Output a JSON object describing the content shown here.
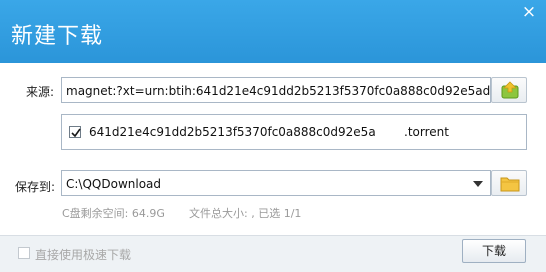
{
  "window": {
    "title": "新建下载",
    "close_glyph": "×"
  },
  "source": {
    "label": "来源:",
    "url": "magnet:?xt=urn:btih:641d21e4c91dd2b5213f5370fc0a888c0d92e5ad",
    "add_icon": "add-torrent-icon"
  },
  "file": {
    "checked": true,
    "name_part1": "641d21e4c91dd2b5213f5370fc0a888c0d92e5a",
    "name_part2": ".torrent"
  },
  "save": {
    "label": "保存到:",
    "path": "C:\\QQDownload",
    "browse_icon": "folder-icon"
  },
  "info": {
    "free_space": "C盘剩余空间: 64.9G",
    "file_summary": "文件总大小: , 已选 1/1"
  },
  "footer": {
    "speed_checkbox_label": "直接使用极速下载",
    "download_label": "下载"
  },
  "colors": {
    "title_bar": "#2f9ee0",
    "footer_bg": "#eef2f5"
  }
}
